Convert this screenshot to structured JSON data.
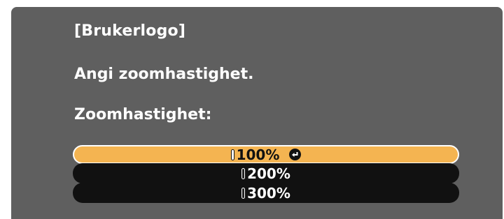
{
  "dialog": {
    "title": "[Brukerlogo]",
    "prompt": "Angi zoomhastighet.",
    "label": "Zoomhastighet:"
  },
  "options": [
    {
      "value": "100%",
      "selected": true
    },
    {
      "value": "200%",
      "selected": false
    },
    {
      "value": "300%",
      "selected": false
    }
  ],
  "icons": {
    "enter": "enter-icon"
  },
  "colors": {
    "panel": "#5f5f5f",
    "selected": "#f4b451",
    "unselected": "#111111"
  }
}
